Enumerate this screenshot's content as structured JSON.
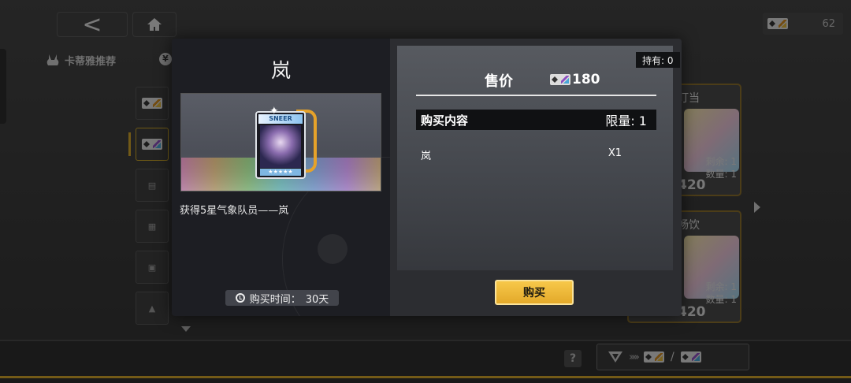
{
  "topbar": {
    "back_glyph": "<",
    "currency_amount": "62"
  },
  "nav": {
    "tab1_label": "卡蒂雅推荐",
    "tab2_label": "¥"
  },
  "cards_bg": [
    {
      "name": "盯当",
      "remain": "剩余: 1",
      "count": "数量: 1",
      "price": "420"
    },
    {
      "name": "畅饮",
      "remain": "剩余: 1",
      "count": "数量: 1",
      "price": "420"
    }
  ],
  "modal": {
    "item_name": "岚",
    "item_card_banner": "SNEER",
    "item_card_stars": "★★★★★",
    "item_description": "获得5星气象队员——岚",
    "purchase_time_label": "购买时间：",
    "purchase_time_value": "30天",
    "holding_text": "持有: 0",
    "price_label": "售价",
    "price_value": "180",
    "content_header": "购买内容",
    "limit_text": "限量: 1",
    "content_items": [
      {
        "name": "岚",
        "qty": "X1"
      }
    ],
    "buy_button": "购买"
  },
  "bottom": {
    "help_glyph": "?",
    "switch_chevrons": "›››››",
    "switch_separator": "/"
  },
  "colors": {
    "accent_gold": "#d1a42b",
    "buy_button": "#f0bb3a",
    "modal_left_bg": "#1d1e23",
    "modal_right_bg": "#2c2d31"
  }
}
